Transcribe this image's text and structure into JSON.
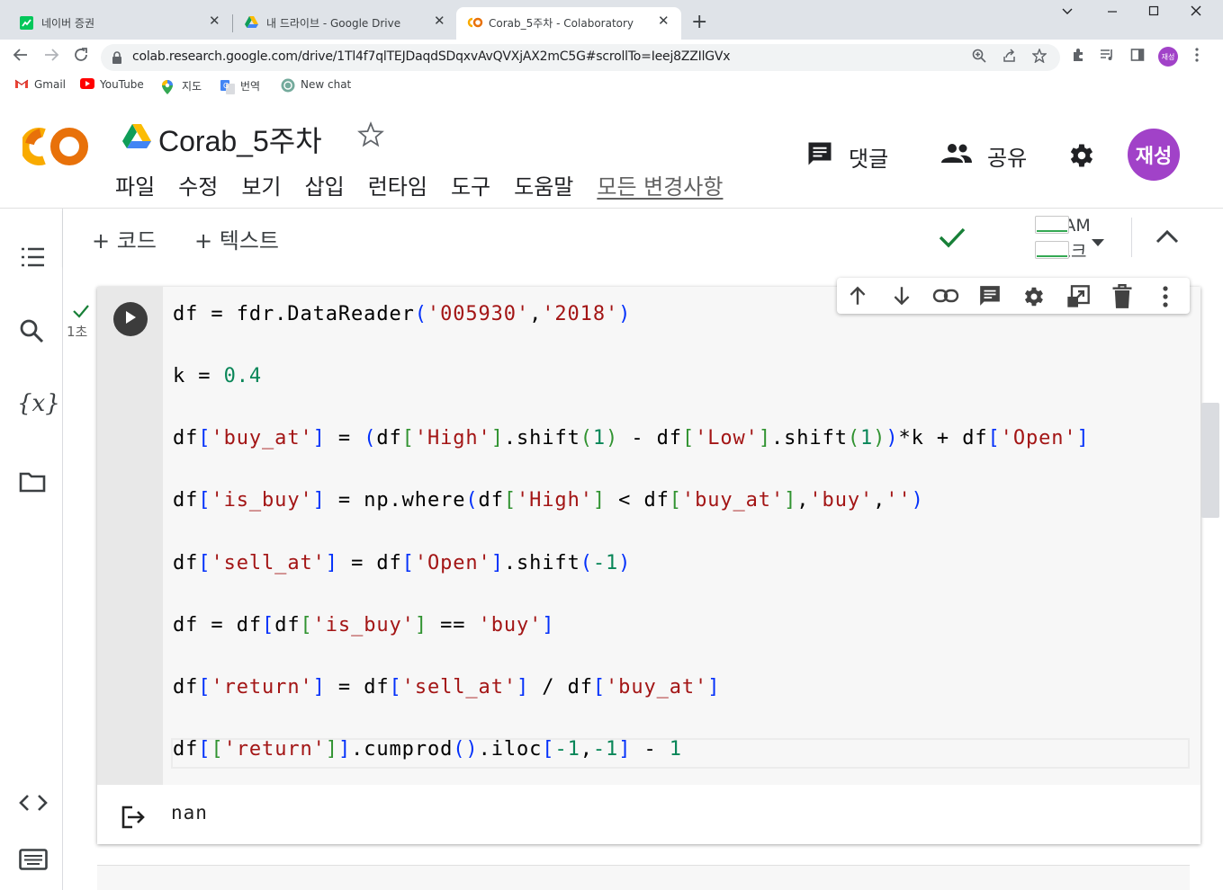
{
  "browser": {
    "tabs": [
      {
        "title": "네이버 증권",
        "icon": "naver-finance-icon",
        "active": false
      },
      {
        "title": "내 드라이브 - Google Drive",
        "icon": "google-drive-icon",
        "active": false
      },
      {
        "title": "Corab_5주차 - Colaboratory",
        "icon": "colab-icon",
        "active": true
      }
    ],
    "url": "colab.research.google.com/drive/1Tl4f7qlTEJDaqdSDqxvAvQVXjAX2mC5G#scrollTo=Ieej8ZZIlGVx",
    "profile_initials": "재성",
    "bookmarks": [
      {
        "label": "Gmail",
        "icon": "gmail-icon"
      },
      {
        "label": "YouTube",
        "icon": "youtube-icon"
      },
      {
        "label": "지도",
        "icon": "maps-icon"
      },
      {
        "label": "번역",
        "icon": "translate-icon"
      },
      {
        "label": "New chat",
        "icon": "chatgpt-icon"
      }
    ]
  },
  "header": {
    "title": "Corab_5주차",
    "menu": [
      "파일",
      "수정",
      "보기",
      "삽입",
      "런타임",
      "도구",
      "도움말"
    ],
    "all_changes": "모든 변경사항",
    "comment_label": "댓글",
    "share_label": "공유",
    "user_initials": "재성"
  },
  "toolbar": {
    "add_code": "+ 코드",
    "add_text": "+ 텍스트",
    "ram_label": "RAM",
    "disk_label": "디스크",
    "status": "connected"
  },
  "cell": {
    "exec_time": "1초",
    "code_lines": [
      [
        [
          "df = fdr.DataReader",
          ""
        ],
        [
          "(",
          "b1"
        ],
        [
          "'005930'",
          "str"
        ],
        [
          ",",
          ""
        ],
        [
          "'2018'",
          "str"
        ],
        [
          ")",
          "b1"
        ]
      ],
      [
        [
          "k = ",
          ""
        ],
        [
          "0.4",
          "num"
        ]
      ],
      [
        [
          "df",
          ""
        ],
        [
          "[",
          "b1"
        ],
        [
          "'buy_at'",
          "str"
        ],
        [
          "]",
          "b1"
        ],
        [
          " = ",
          ""
        ],
        [
          "(",
          "b1"
        ],
        [
          "df",
          ""
        ],
        [
          "[",
          "b2"
        ],
        [
          "'High'",
          "str"
        ],
        [
          "]",
          "b2"
        ],
        [
          ".shift",
          ""
        ],
        [
          "(",
          "b2"
        ],
        [
          "1",
          "num"
        ],
        [
          ")",
          "b2"
        ],
        [
          " - df",
          ""
        ],
        [
          "[",
          "b2"
        ],
        [
          "'Low'",
          "str"
        ],
        [
          "]",
          "b2"
        ],
        [
          ".shift",
          ""
        ],
        [
          "(",
          "b2"
        ],
        [
          "1",
          "num"
        ],
        [
          ")",
          "b2"
        ],
        [
          ")",
          "b1"
        ],
        [
          "*k + df",
          ""
        ],
        [
          "[",
          "b1"
        ],
        [
          "'Open'",
          "str"
        ],
        [
          "]",
          "b1"
        ]
      ],
      [
        [
          "df",
          ""
        ],
        [
          "[",
          "b1"
        ],
        [
          "'is_buy'",
          "str"
        ],
        [
          "]",
          "b1"
        ],
        [
          " = np.where",
          ""
        ],
        [
          "(",
          "b1"
        ],
        [
          "df",
          ""
        ],
        [
          "[",
          "b2"
        ],
        [
          "'High'",
          "str"
        ],
        [
          "]",
          "b2"
        ],
        [
          " < df",
          ""
        ],
        [
          "[",
          "b2"
        ],
        [
          "'buy_at'",
          "str"
        ],
        [
          "]",
          "b2"
        ],
        [
          ",",
          ""
        ],
        [
          "'buy'",
          "str"
        ],
        [
          ",",
          ""
        ],
        [
          "''",
          "str"
        ],
        [
          ")",
          "b1"
        ]
      ],
      [
        [
          "df",
          ""
        ],
        [
          "[",
          "b1"
        ],
        [
          "'sell_at'",
          "str"
        ],
        [
          "]",
          "b1"
        ],
        [
          " = df",
          ""
        ],
        [
          "[",
          "b1"
        ],
        [
          "'Open'",
          "str"
        ],
        [
          "]",
          "b1"
        ],
        [
          ".shift",
          ""
        ],
        [
          "(",
          "b1"
        ],
        [
          "-1",
          "num"
        ],
        [
          ")",
          "b1"
        ]
      ],
      [
        [
          "df = df",
          ""
        ],
        [
          "[",
          "b1"
        ],
        [
          "df",
          ""
        ],
        [
          "[",
          "b2"
        ],
        [
          "'is_buy'",
          "str"
        ],
        [
          "]",
          "b2"
        ],
        [
          " == ",
          ""
        ],
        [
          "'buy'",
          "str"
        ],
        [
          "]",
          "b1"
        ]
      ],
      [
        [
          "df",
          ""
        ],
        [
          "[",
          "b1"
        ],
        [
          "'return'",
          "str"
        ],
        [
          "]",
          "b1"
        ],
        [
          " = df",
          ""
        ],
        [
          "[",
          "b1"
        ],
        [
          "'sell_at'",
          "str"
        ],
        [
          "]",
          "b1"
        ],
        [
          " / df",
          ""
        ],
        [
          "[",
          "b1"
        ],
        [
          "'buy_at'",
          "str"
        ],
        [
          "]",
          "b1"
        ]
      ],
      [
        [
          "df",
          ""
        ],
        [
          "[",
          "b1"
        ],
        [
          "[",
          "b2"
        ],
        [
          "'return'",
          "str"
        ],
        [
          "]",
          "b2"
        ],
        [
          "]",
          "b1"
        ],
        [
          ".cumprod",
          ""
        ],
        [
          "()",
          "b1"
        ],
        [
          ".iloc",
          ""
        ],
        [
          "[",
          "b1"
        ],
        [
          "-1",
          "num"
        ],
        [
          ",",
          ""
        ],
        [
          "-1",
          "num"
        ],
        [
          "]",
          "b1"
        ],
        [
          " - ",
          ""
        ],
        [
          "1",
          "num"
        ]
      ]
    ],
    "output": "nan"
  },
  "colors": {
    "string": "#a31515",
    "number": "#098658",
    "bracket_level1": "#0431fa",
    "bracket_level2": "#319331",
    "avatar": "#a142c8",
    "check": "#188038"
  }
}
